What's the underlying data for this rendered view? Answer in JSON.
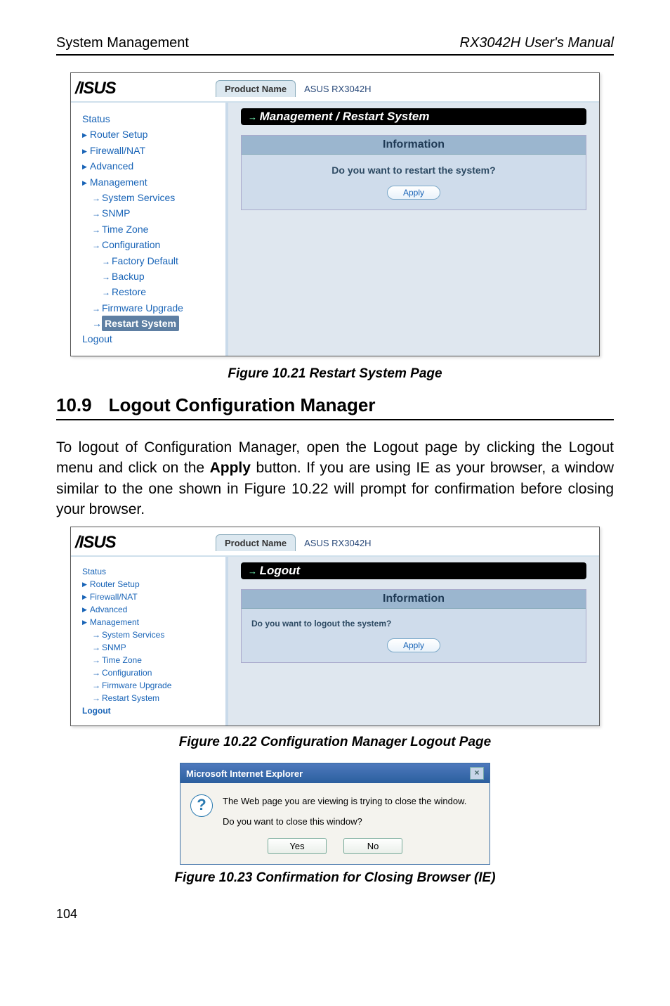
{
  "header": {
    "left": "System Management",
    "right": "RX3042H User's Manual"
  },
  "fig21": {
    "product_tab": "Product Name",
    "product_value": "ASUS RX3042H",
    "nav": {
      "status": "Status",
      "router_setup": "Router Setup",
      "firewall_nat": "Firewall/NAT",
      "advanced": "Advanced",
      "management": "Management",
      "system_services": "System Services",
      "snmp": "SNMP",
      "time_zone": "Time Zone",
      "configuration": "Configuration",
      "factory_default": "Factory Default",
      "backup": "Backup",
      "restore": "Restore",
      "firmware_upgrade": "Firmware Upgrade",
      "restart_system": "Restart System",
      "logout": "Logout"
    },
    "title": "Management / Restart System",
    "panel_head": "Information",
    "question": "Do you want to restart the system?",
    "apply": "Apply",
    "caption": "Figure 10.21 Restart System Page"
  },
  "section": {
    "num": "10.9",
    "title": "Logout Configuration Manager"
  },
  "para": {
    "t1": "To logout of Configuration Manager, open the Logout page by clicking the Logout menu and click on the ",
    "apply": "Apply",
    "t2": " button. If you are using IE as your browser, a window similar to the one shown in Figure 10.22 will prompt for confirmation before closing your browser."
  },
  "fig22": {
    "product_tab": "Product Name",
    "product_value": "ASUS RX3042H",
    "nav": {
      "status": "Status",
      "router_setup": "Router Setup",
      "firewall_nat": "Firewall/NAT",
      "advanced": "Advanced",
      "management": "Management",
      "system_services": "System Services",
      "snmp": "SNMP",
      "time_zone": "Time Zone",
      "configuration": "Configuration",
      "firmware_upgrade": "Firmware Upgrade",
      "restart_system": "Restart System",
      "logout": "Logout"
    },
    "title": "Logout",
    "panel_head": "Information",
    "question": "Do you want to logout the system?",
    "apply": "Apply",
    "caption": "Figure 10.22 Configuration Manager Logout Page"
  },
  "ie": {
    "title": "Microsoft Internet Explorer",
    "line1": "The Web page you are viewing is trying to close the window.",
    "line2": "Do you want to close this window?",
    "yes": "Yes",
    "no": "No",
    "caption": "Figure 10.23 Confirmation for Closing Browser (IE)"
  },
  "page_number": "104"
}
